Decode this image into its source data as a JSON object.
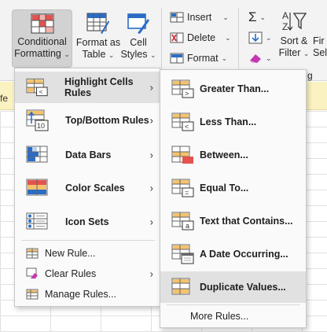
{
  "ribbon": {
    "conditional_formatting": {
      "line1": "Conditional",
      "line2": "Formatting"
    },
    "format_as_table": {
      "line1": "Format as",
      "line2": "Table"
    },
    "cell_styles": {
      "line1": "Cell",
      "line2": "Styles"
    },
    "insert": "Insert",
    "delete": "Delete",
    "format": "Format",
    "sort_filter": {
      "line1": "Sort &",
      "line2": "Filter"
    },
    "find_select": {
      "line1": "Fir",
      "line2": "Sel"
    },
    "group_label_fragment": "g",
    "sigma": "Σ"
  },
  "warning_fragment": "fe",
  "main_menu": {
    "items": [
      {
        "label": "Highlight Cells Rules",
        "hotkey": "H",
        "icon": "highlight-cells-icon"
      },
      {
        "label": "Top/Bottom Rules",
        "hotkey": "T",
        "icon": "top-bottom-icon"
      },
      {
        "label": "Data Bars",
        "hotkey": "D",
        "icon": "data-bars-icon"
      },
      {
        "label": "Color Scales",
        "hotkey": "S",
        "icon": "color-scales-icon"
      },
      {
        "label": "Icon Sets",
        "hotkey": "I",
        "icon": "icon-sets-icon"
      }
    ],
    "small_items": [
      {
        "label": "New Rule...",
        "icon": "new-rule-icon"
      },
      {
        "label": "Clear Rules",
        "icon": "clear-rules-icon"
      },
      {
        "label": "Manage Rules...",
        "icon": "manage-rules-icon"
      }
    ]
  },
  "sub_menu": {
    "items": [
      {
        "label": "Greater Than...",
        "icon": "greater-than-icon"
      },
      {
        "label": "Less Than...",
        "icon": "less-than-icon"
      },
      {
        "label": "Between...",
        "icon": "between-icon"
      },
      {
        "label": "Equal To...",
        "icon": "equal-to-icon"
      },
      {
        "label": "Text that Contains...",
        "icon": "text-contains-icon"
      },
      {
        "label": "A Date Occurring...",
        "icon": "date-occurring-icon"
      },
      {
        "label": "Duplicate Values...",
        "icon": "duplicate-values-icon"
      }
    ],
    "more_rules": "More Rules..."
  },
  "colors": {
    "accent_blue": "#2b6cc4",
    "icon_orange": "#f5c26b",
    "selection_gray": "#e1e1e1"
  }
}
